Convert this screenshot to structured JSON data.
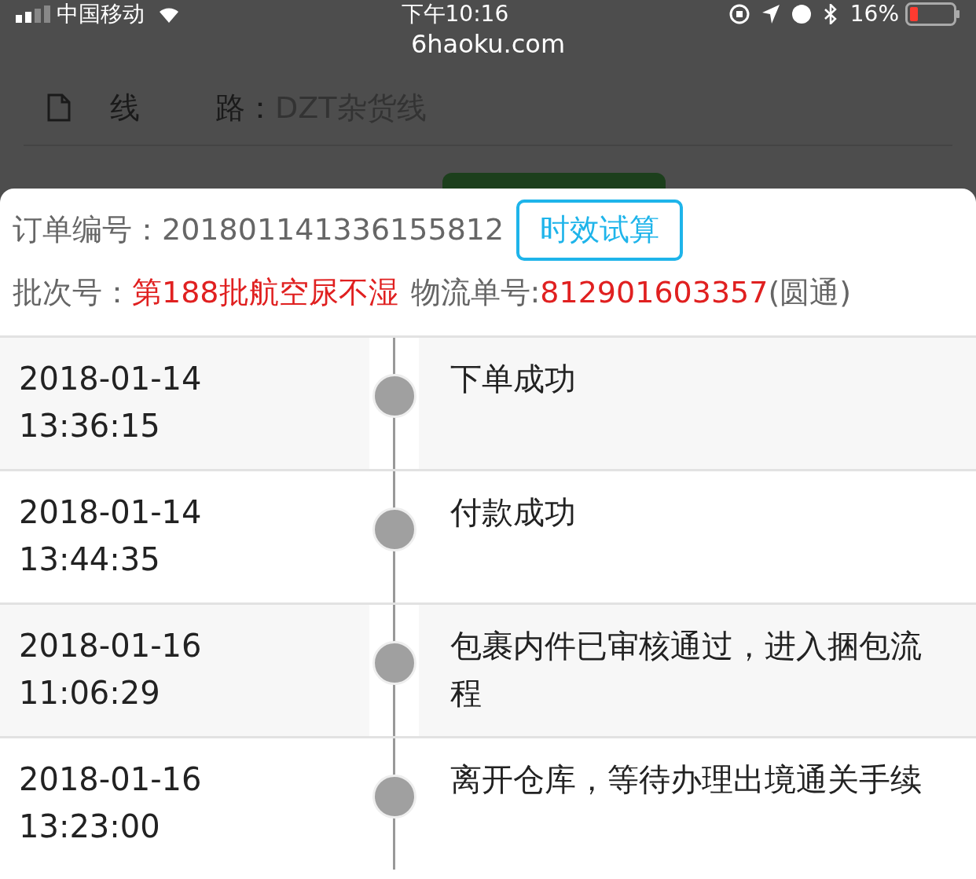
{
  "status_bar": {
    "carrier": "中国移动",
    "time": "下午10:16",
    "battery": "16%"
  },
  "url": "6haoku.com",
  "background": {
    "route_label_1": "线",
    "route_label_2": "路：",
    "route_value": "DZT杂货线"
  },
  "order": {
    "label": "订单编号：",
    "number": "201801141336155812",
    "button": "时效试算"
  },
  "batch": {
    "label": "批次号：",
    "value": "第188批航空尿不湿",
    "tracking_label": "物流单号:",
    "tracking_number": "812901603357",
    "carrier": "(圆通)"
  },
  "timeline": [
    {
      "date": "2018-01-14",
      "time": "13:36:15",
      "status": "下单成功"
    },
    {
      "date": "2018-01-14",
      "time": "13:44:35",
      "status": "付款成功"
    },
    {
      "date": "2018-01-16",
      "time": "11:06:29",
      "status": "包裹内件已审核通过，进入捆包流程"
    },
    {
      "date": "2018-01-16",
      "time": "13:23:00",
      "status": "离开仓库，等待办理出境通关手续"
    }
  ]
}
